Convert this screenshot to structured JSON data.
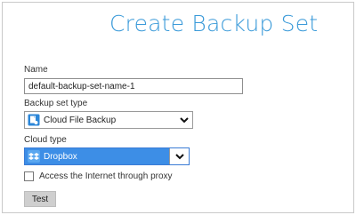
{
  "dialog": {
    "title": "Create Backup Set"
  },
  "name_field": {
    "label": "Name",
    "value": "default-backup-set-name-1"
  },
  "backup_type": {
    "label": "Backup set type",
    "selected": "Cloud File Backup",
    "icon": "cloud-file-backup-icon"
  },
  "cloud_type": {
    "label": "Cloud type",
    "selected": "Dropbox",
    "icon": "dropbox-icon"
  },
  "proxy": {
    "label": "Access the Internet through proxy",
    "checked": false
  },
  "test_button": {
    "label": "Test"
  },
  "colors": {
    "title": "#3a9ad9",
    "selection": "#3d8ee6",
    "button": "#cfcfcf"
  }
}
